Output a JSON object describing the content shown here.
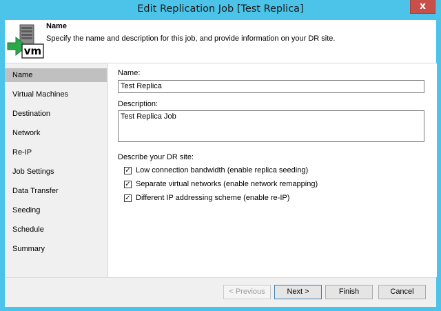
{
  "window": {
    "title": "Edit Replication Job [Test Replica]",
    "close_glyph": "x"
  },
  "header": {
    "icon": "vm-import-icon",
    "title": "Name",
    "description": "Specify the name and description for this job, and provide information on your DR site."
  },
  "sidebar": {
    "active": "Name",
    "items": [
      {
        "label": "Name"
      },
      {
        "label": "Virtual Machines"
      },
      {
        "label": "Destination"
      },
      {
        "label": "Network"
      },
      {
        "label": "Re-IP"
      },
      {
        "label": "Job Settings"
      },
      {
        "label": "Data Transfer"
      },
      {
        "label": "Seeding"
      },
      {
        "label": "Schedule"
      },
      {
        "label": "Summary"
      }
    ]
  },
  "form": {
    "name_label": "Name:",
    "name_value": "Test Replica",
    "description_label": "Description:",
    "description_value": "Test Replica Job",
    "dr_site_label": "Describe your DR site:",
    "options": [
      {
        "label": "Low connection bandwidth (enable replica seeding)",
        "checked": true
      },
      {
        "label": "Separate virtual networks (enable network remapping)",
        "checked": true
      },
      {
        "label": "Different IP addressing scheme (enable re-IP)",
        "checked": true
      }
    ]
  },
  "footer": {
    "previous": "< Previous",
    "next": "Next >",
    "finish": "Finish",
    "cancel": "Cancel"
  },
  "colors": {
    "titlebar": "#4cc4ea",
    "close": "#c7504a",
    "selected_nav": "#c0c0c0",
    "vm_icon_accent": "#2aa84a"
  }
}
